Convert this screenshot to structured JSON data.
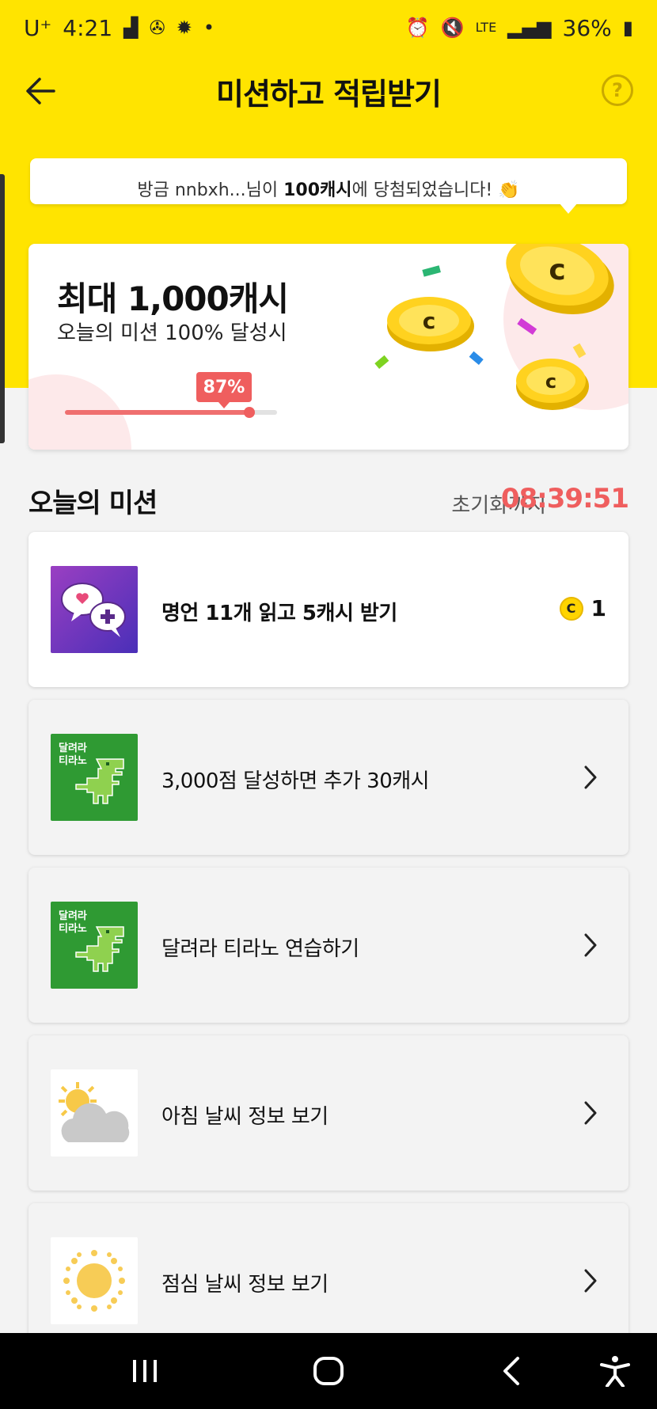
{
  "status_bar": {
    "carrier": "U⁺",
    "time": "4:21",
    "network": "LTE",
    "battery": "36%"
  },
  "header": {
    "title": "미션하고 적립받기",
    "help": "?"
  },
  "winner_banner": {
    "prefix": "방금 nnbxh...님이 ",
    "amount": "100캐시",
    "suffix": "에 당첨되었습니다! 👏"
  },
  "reward": {
    "amount": "최대 1,000캐시",
    "subtitle": "오늘의 미션 100% 달성시",
    "progress_label": "87%",
    "progress": 0.87
  },
  "missions_section": {
    "title": "오늘의 미션",
    "reset_label": "초기화까지",
    "reset_time": "08:39:51"
  },
  "missions": [
    {
      "label": "명언 11개 읽고 5캐시 받기",
      "icon": "quote-chat-icon",
      "coin": "1",
      "coin_mark": "C",
      "active": true
    },
    {
      "label": "3,000점 달성하면 추가 30캐시",
      "icon": "dino-game-icon",
      "icon_text": "달려라\n티라노"
    },
    {
      "label": "달려라 티라노 연습하기",
      "icon": "dino-game-icon",
      "icon_text": "달려라\n티라노"
    },
    {
      "label": "아침 날씨 정보 보기",
      "icon": "sun-cloud-icon"
    },
    {
      "label": "점심 날씨 정보 보기",
      "icon": "sun-icon"
    }
  ],
  "colors": {
    "brand_yellow": "#ffe400",
    "accent_red": "#ef5e5e"
  }
}
